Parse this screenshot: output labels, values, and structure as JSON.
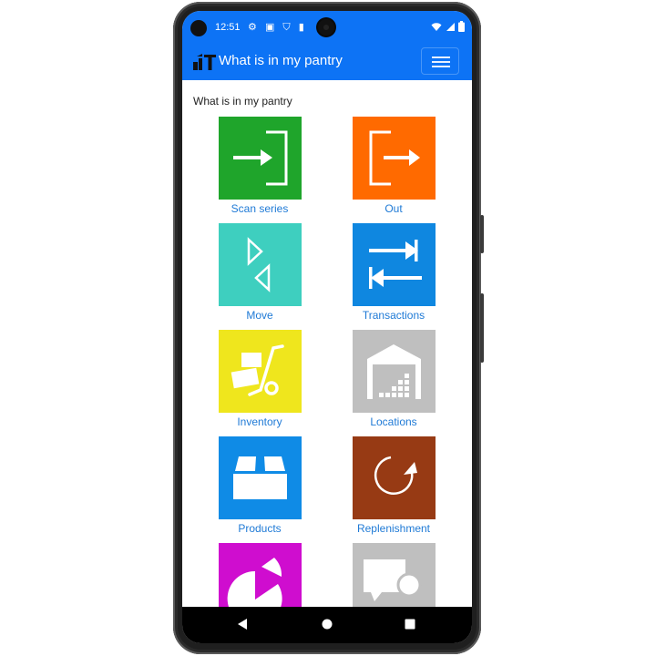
{
  "status_bar": {
    "time": "12:51",
    "left_icons": [
      "gear-icon",
      "translate-icon",
      "shield-icon",
      "sd-card-icon"
    ],
    "right_icons": [
      "wifi-icon",
      "signal-icon",
      "battery-icon"
    ]
  },
  "app_bar": {
    "logo": "warehouse-logo-icon",
    "title": "What is in my pantry",
    "menu_icon": "hamburger-menu-icon"
  },
  "page": {
    "section_title": "What is in my pantry"
  },
  "tiles": [
    {
      "label": "Scan series",
      "color": "#1fa52b",
      "icon": "sign-in-icon"
    },
    {
      "label": "Out",
      "color": "#ff6a00",
      "icon": "sign-out-icon"
    },
    {
      "label": "Move",
      "color": "#3ecfbf",
      "icon": "move-triangles-icon"
    },
    {
      "label": "Transactions",
      "color": "#0f87e0",
      "icon": "swap-arrows-icon"
    },
    {
      "label": "Inventory",
      "color": "#efe61d",
      "icon": "hand-truck-icon"
    },
    {
      "label": "Locations",
      "color": "#bfbfbf",
      "icon": "warehouse-icon"
    },
    {
      "label": "Products",
      "color": "#0f8be6",
      "icon": "box-icon"
    },
    {
      "label": "Replenishment",
      "color": "#973a14",
      "icon": "refresh-icon"
    },
    {
      "label": "",
      "color": "#cf0dcf",
      "icon": "pie-chart-icon"
    },
    {
      "label": "",
      "color": "#bfbfbf",
      "icon": "chat-user-icon"
    }
  ],
  "nav_bar": {
    "icons": [
      "back-icon",
      "home-icon",
      "recents-icon"
    ]
  }
}
